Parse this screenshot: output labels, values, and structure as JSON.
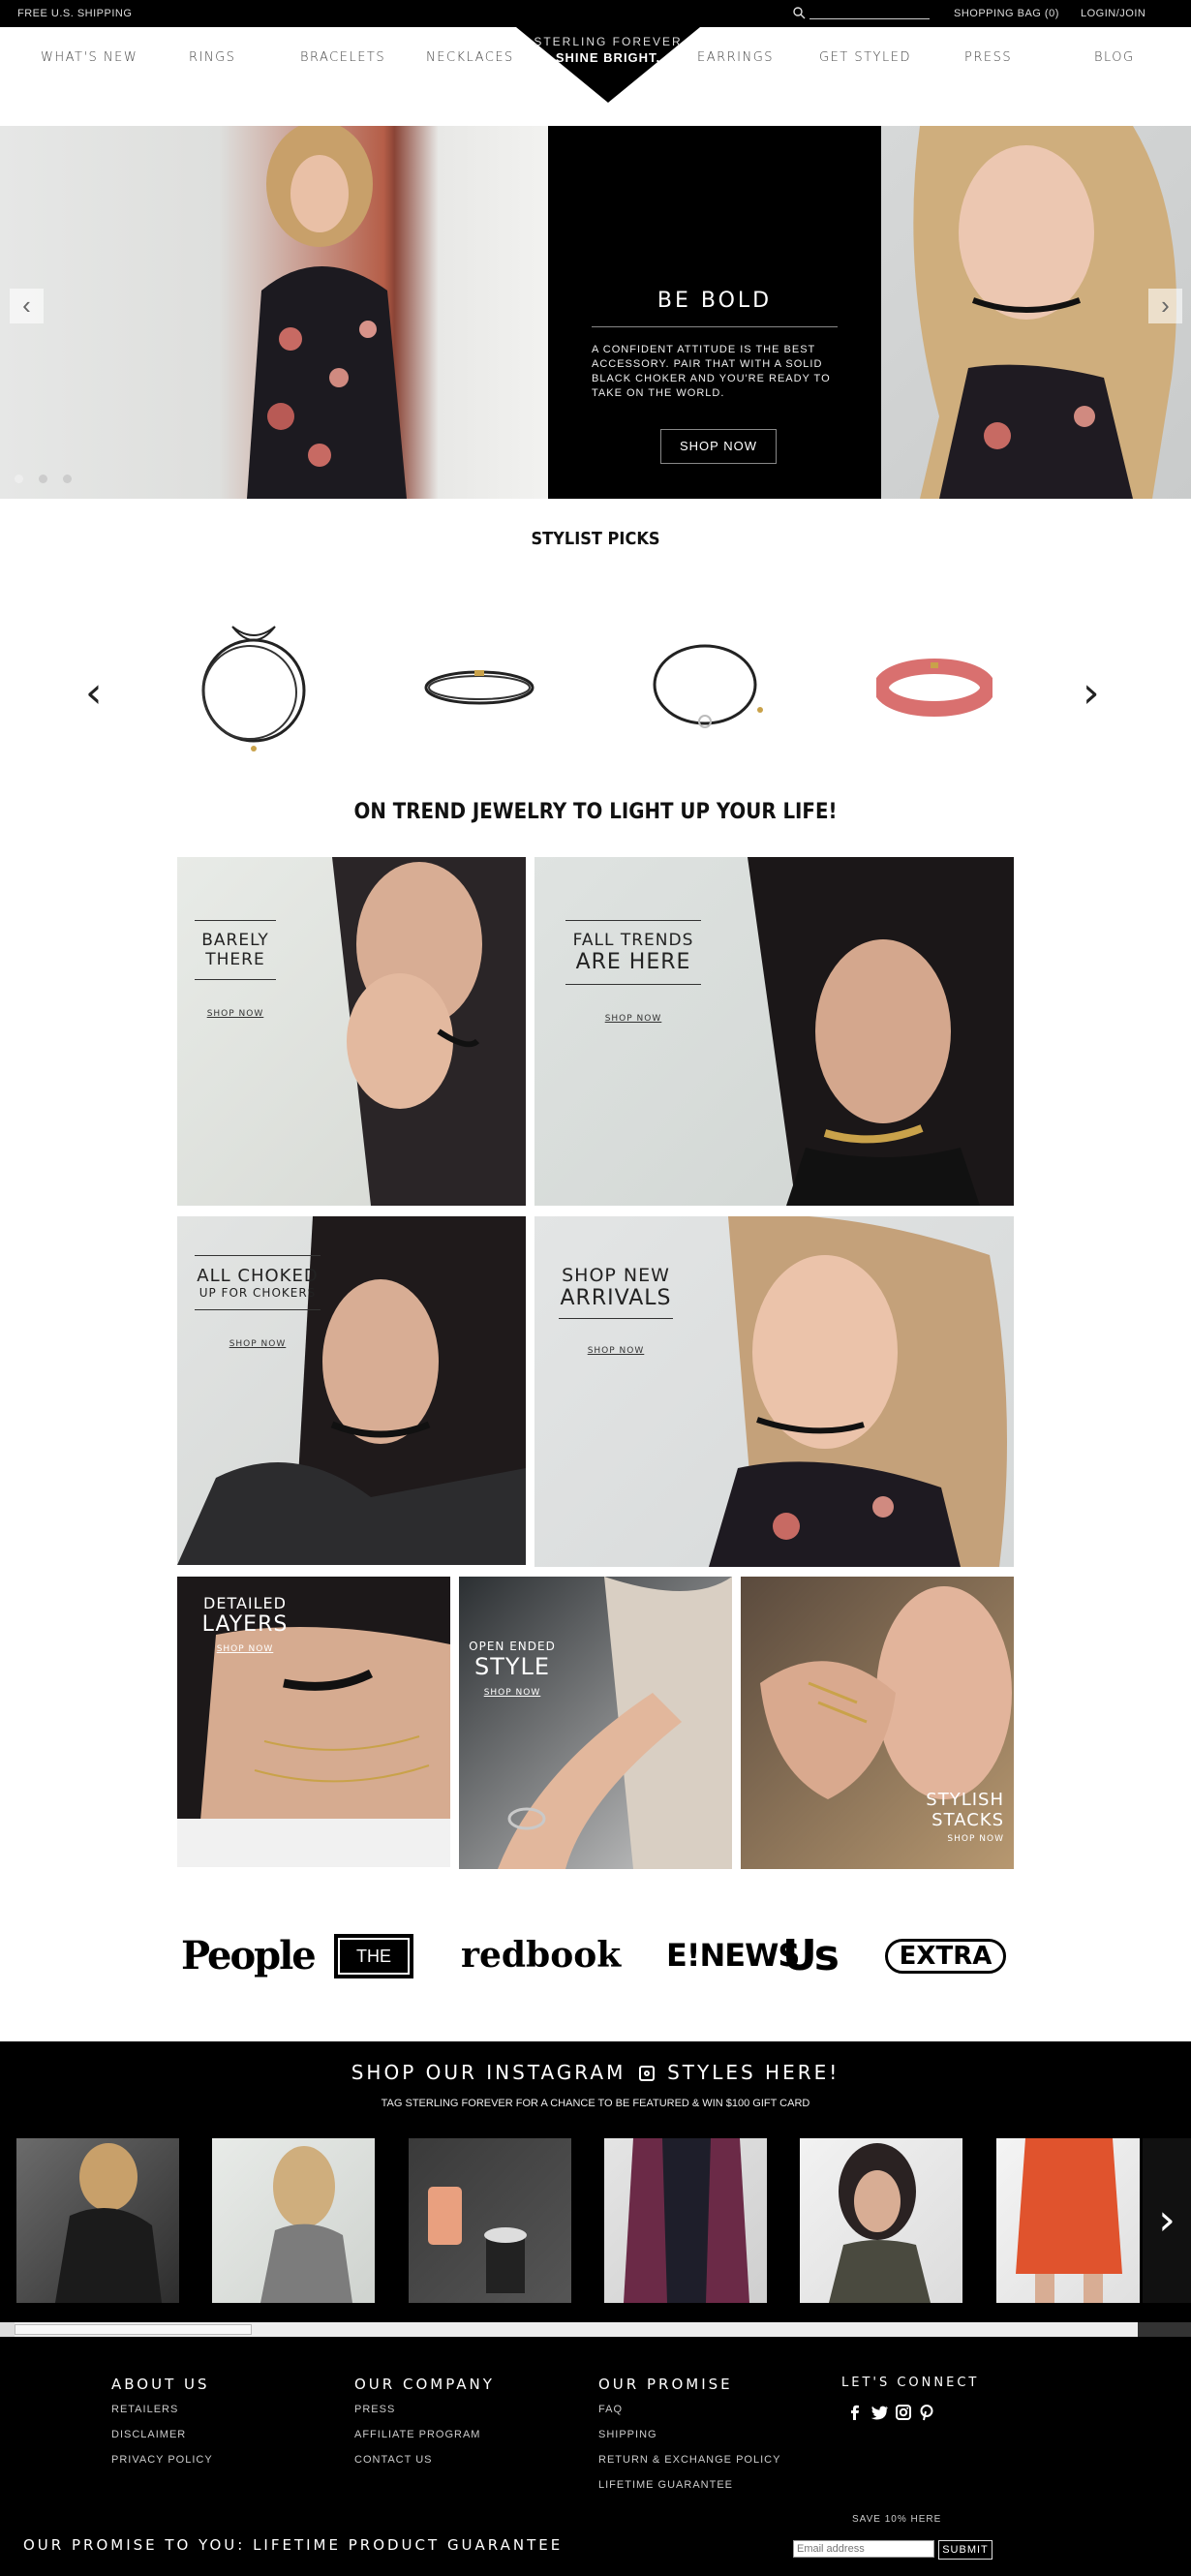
{
  "topbar": {
    "free_shipping": "FREE U.S. SHIPPING",
    "shopping_bag": "SHOPPING BAG (0)",
    "login": "LOGIN/JOIN"
  },
  "nav": {
    "left": [
      "WHAT'S NEW",
      "RINGS",
      "BRACELETS",
      "NECKLACES"
    ],
    "right": [
      "EARRINGS",
      "GET STYLED",
      "PRESS",
      "BLOG"
    ],
    "logo_line1": "STERLING FOREVER",
    "logo_line2": "SHINE BRIGHT."
  },
  "hero": {
    "heading": "BE BOLD",
    "body": "A CONFIDENT ATTITUDE IS THE BEST ACCESSORY. PAIR THAT WITH A SOLID BLACK CHOKER AND YOU'RE READY TO TAKE ON THE WORLD.",
    "cta": "SHOP NOW",
    "prev": "‹",
    "next": "›"
  },
  "stylist": {
    "title": "STYLIST PICKS",
    "prev": "‹",
    "next": "›"
  },
  "trend": {
    "title": "ON TREND JEWELRY TO LIGHT UP YOUR LIFE!",
    "tiles": [
      {
        "line1": "BARELY",
        "line2": "THERE",
        "cta": "SHOP NOW"
      },
      {
        "line1": "FALL TRENDS",
        "line2": "ARE HERE",
        "cta": "SHOP NOW"
      },
      {
        "line1": "ALL CHOKED",
        "line2": "UP FOR CHOKERS",
        "cta": "SHOP NOW"
      },
      {
        "line1": "SHOP NEW",
        "line2": "ARRIVALS",
        "cta": "SHOP NOW"
      },
      {
        "line1": "DETAILED",
        "line2": "LAYERS",
        "cta": "SHOP NOW"
      },
      {
        "line1": "OPEN ENDED",
        "line2": "STYLE",
        "cta": "SHOP NOW"
      },
      {
        "line1": "STYLISH",
        "line2": "STACKS",
        "cta": "SHOP NOW"
      }
    ]
  },
  "press": {
    "logos": [
      "People",
      "THE TALK",
      "redbook",
      "E!NEWS",
      "Us",
      "EXTRA"
    ]
  },
  "instagram": {
    "title_a": "SHOP OUR INSTAGRAM",
    "title_b": "STYLES HERE!",
    "subtitle": "TAG STERLING FOREVER FOR A CHANCE TO BE FEATURED & WIN $100 GIFT CARD",
    "next": "›"
  },
  "footer": {
    "about": {
      "title": "ABOUT US",
      "links": [
        "RETAILERS",
        "DISCLAIMER",
        "PRIVACY POLICY"
      ]
    },
    "company": {
      "title": "OUR COMPANY",
      "links": [
        "PRESS",
        "AFFILIATE PROGRAM",
        "CONTACT US"
      ]
    },
    "promise": {
      "title": "OUR PROMISE",
      "links": [
        "FAQ",
        "SHIPPING",
        "RETURN & EXCHANGE POLICY",
        "LIFETIME GUARANTEE"
      ]
    },
    "connect": {
      "title": "LET'S CONNECT"
    },
    "guarantee": "OUR PROMISE TO YOU: LIFETIME PRODUCT GUARANTEE",
    "save": "SAVE 10% HERE",
    "email_placeholder": "Email address",
    "submit": "SUBMIT"
  }
}
